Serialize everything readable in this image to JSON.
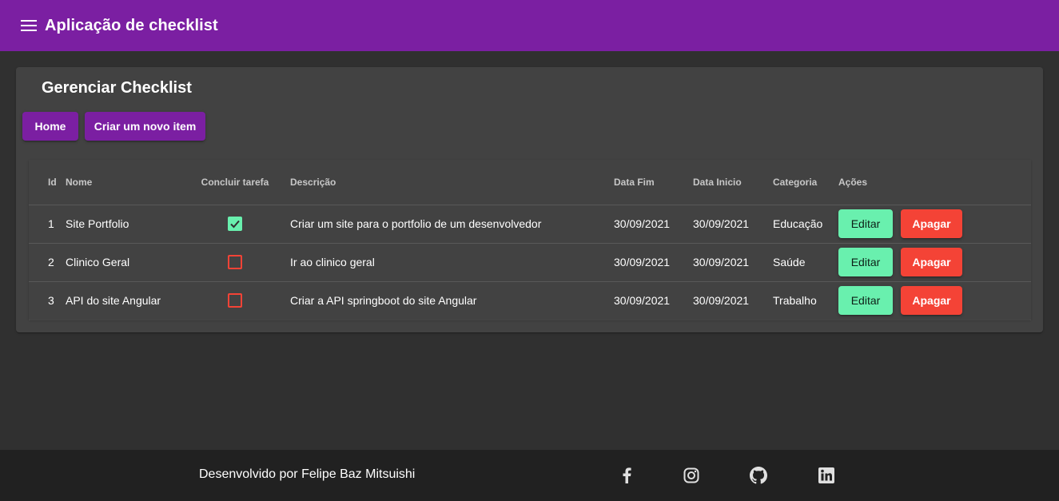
{
  "app": {
    "title": "Aplicação de checklist"
  },
  "card": {
    "title": "Gerenciar Checklist",
    "home_label": "Home",
    "new_item_label": "Criar um novo item"
  },
  "table": {
    "headers": {
      "id": "Id",
      "nome": "Nome",
      "concluir": "Concluir tarefa",
      "descricao": "Descrição",
      "data_fim": "Data Fim",
      "data_inicio": "Data Inicio",
      "categoria": "Categoria",
      "acoes": "Ações"
    },
    "rows": [
      {
        "id": "1",
        "nome": "Site Portfolio",
        "concluido": true,
        "descricao": "Criar um site para o portfolio de um desenvolvedor",
        "data_fim": "30/09/2021",
        "data_inicio": "30/09/2021",
        "categoria": "Educação",
        "edit_label": "Editar",
        "delete_label": "Apagar"
      },
      {
        "id": "2",
        "nome": "Clinico Geral",
        "concluido": false,
        "descricao": "Ir ao clinico geral",
        "data_fim": "30/09/2021",
        "data_inicio": "30/09/2021",
        "categoria": "Saúde",
        "edit_label": "Editar",
        "delete_label": "Apagar"
      },
      {
        "id": "3",
        "nome": "API do site Angular",
        "concluido": false,
        "descricao": "Criar a API springboot do site Angular",
        "data_fim": "30/09/2021",
        "data_inicio": "30/09/2021",
        "categoria": "Trabalho",
        "edit_label": "Editar",
        "delete_label": "Apagar"
      }
    ]
  },
  "footer": {
    "text": "Desenvolvido por Felipe Baz Mitsuishi",
    "social_icons": [
      "facebook-icon",
      "instagram-icon",
      "github-icon",
      "linkedin-icon"
    ]
  },
  "colors": {
    "primary": "#7b1fa2",
    "accent": "#69f0ae",
    "warn": "#f44336",
    "background": "#303030",
    "card": "#424242",
    "footer": "#212121"
  }
}
